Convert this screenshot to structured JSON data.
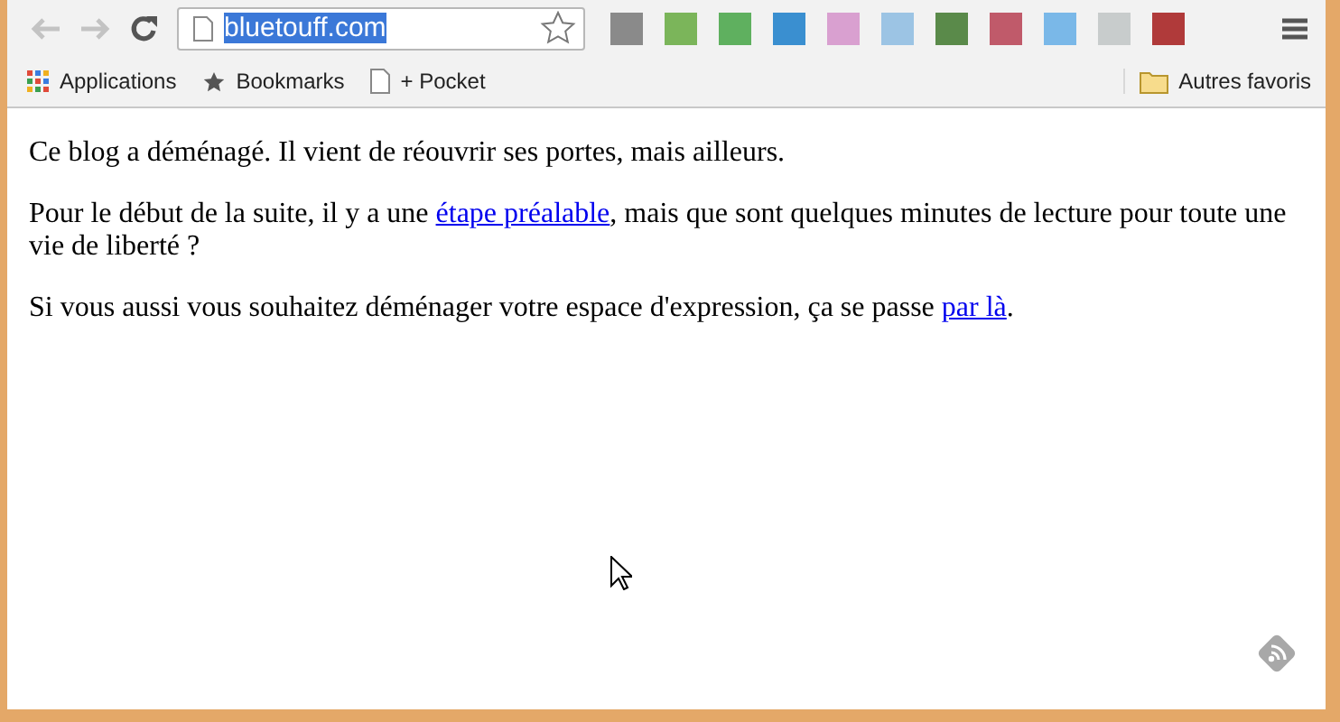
{
  "toolbar": {
    "url": "bluetouff.com",
    "url_selected": true,
    "extensions": [
      {
        "color": "#8a8a8a"
      },
      {
        "color": "#7bb55a"
      },
      {
        "color": "#5fb05f"
      },
      {
        "color": "#3a8fd0"
      },
      {
        "color": "#d9a0d0"
      },
      {
        "color": "#9cc4e4"
      },
      {
        "color": "#5a8a4a"
      },
      {
        "color": "#c05a6a"
      },
      {
        "color": "#7ab8e8"
      },
      {
        "color": "#c8cccc"
      },
      {
        "color": "#b03a3a"
      }
    ]
  },
  "bookmarks": {
    "items": [
      {
        "kind": "apps",
        "label": "Applications"
      },
      {
        "kind": "star",
        "label": "Bookmarks"
      },
      {
        "kind": "page",
        "label": "+ Pocket"
      }
    ],
    "other": "Autres favoris"
  },
  "paragraphs": [
    [
      {
        "kind": "text",
        "text": "Ce blog a déménagé. Il vient de réouvrir ses portes, mais ailleurs."
      }
    ],
    [
      {
        "kind": "text",
        "text": "Pour le début de la suite, il y a une "
      },
      {
        "kind": "link",
        "text": "étape préalable"
      },
      {
        "kind": "text",
        "text": ", mais que sont quelques minutes de lecture pour toute une vie de liberté ?"
      }
    ],
    [
      {
        "kind": "text",
        "text": "Si vous aussi vous souhaitez déménager votre espace d'expression, ça se passe "
      },
      {
        "kind": "link",
        "text": "par là"
      },
      {
        "kind": "text",
        "text": "."
      }
    ]
  ]
}
